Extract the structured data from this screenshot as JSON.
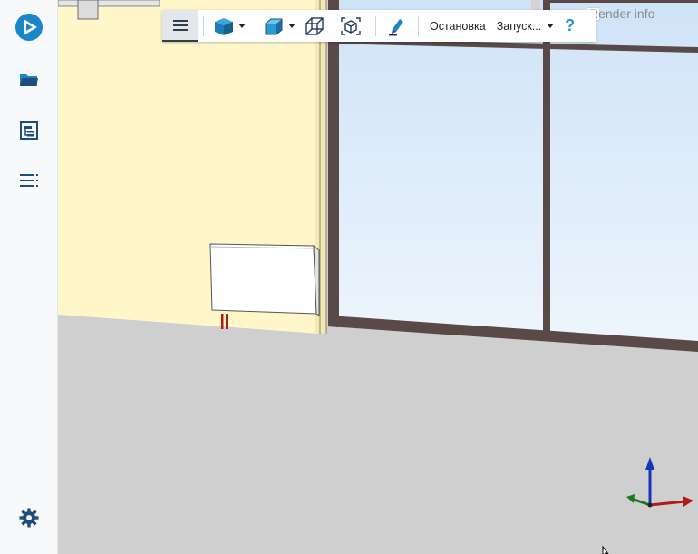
{
  "sidebar": {
    "items": [
      {
        "icon": "app-logo-icon"
      },
      {
        "icon": "folder-icon"
      },
      {
        "icon": "model-tree-icon"
      },
      {
        "icon": "list-icon"
      }
    ],
    "settings_icon": "gear-icon"
  },
  "toolbar": {
    "menu_icon": "hamburger-icon",
    "buttons": [
      {
        "icon": "solid-cube-icon"
      },
      {
        "icon": "projection-cube-icon"
      },
      {
        "icon": "wireframe-cube-icon"
      },
      {
        "icon": "fit-view-icon"
      },
      {
        "icon": "pencil-icon"
      }
    ],
    "stop_label": "Остановка",
    "launch_label": "Запуск...",
    "help_label": "?"
  },
  "overlay": {
    "render_info_label": "Render info"
  },
  "colors": {
    "accent": "#1a8fd0",
    "brand": "#1e4d7b",
    "wall": "#fff7c9",
    "floor": "#cfcfcf",
    "window_frame": "#5a4a47",
    "glass_top": "#cfe3f7",
    "glass_bottom": "#ecf4fd"
  }
}
